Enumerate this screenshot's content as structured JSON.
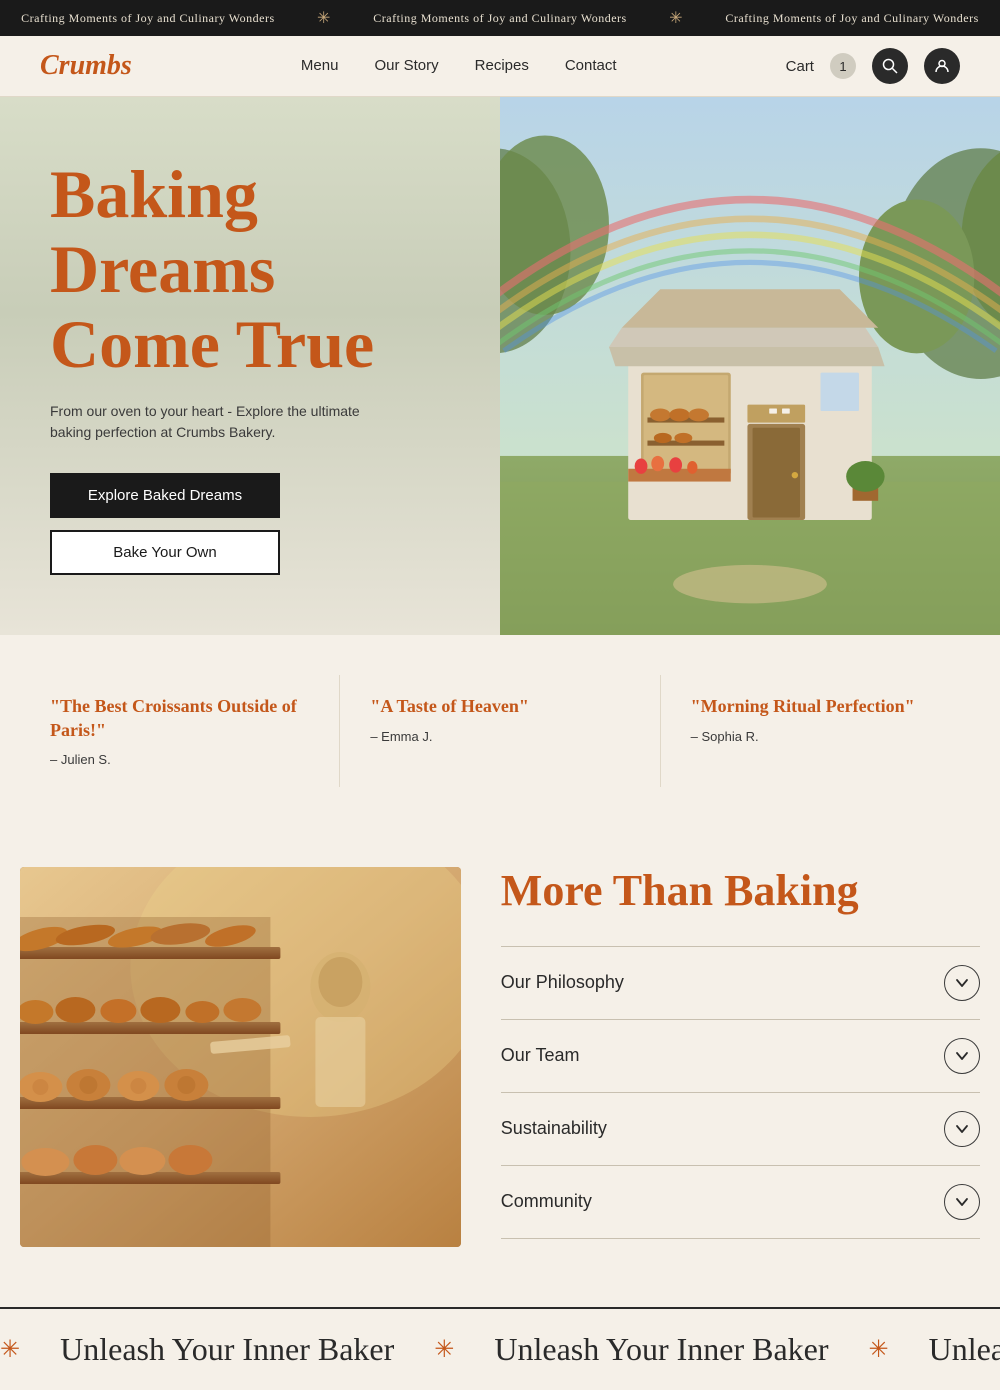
{
  "announcement": {
    "text": "Crafting Moments of Joy and Culinary Wonders",
    "separator": "✳"
  },
  "header": {
    "logo": "Crumbs",
    "nav": [
      {
        "label": "Menu",
        "href": "#"
      },
      {
        "label": "Our Story",
        "href": "#"
      },
      {
        "label": "Recipes",
        "href": "#"
      },
      {
        "label": "Contact",
        "href": "#"
      }
    ],
    "cart_label": "Cart",
    "cart_count": "1"
  },
  "hero": {
    "title_line1": "Baking",
    "title_line2": "Dreams",
    "title_line3": "Come True",
    "subtitle": "From our oven to your heart - Explore the ultimate baking perfection at Crumbs Bakery.",
    "btn_primary": "Explore Baked Dreams",
    "btn_secondary": "Bake Your Own"
  },
  "testimonials": [
    {
      "quote": "\"The Best Croissants Outside of Paris!\"",
      "author": "– Julien S."
    },
    {
      "quote": "\"A Taste of Heaven\"",
      "author": "– Emma J."
    },
    {
      "quote": "\"Morning Ritual Perfection\"",
      "author": "– Sophia R."
    }
  ],
  "more_than_baking": {
    "heading": "More Than Baking",
    "accordion": [
      {
        "label": "Our Philosophy"
      },
      {
        "label": "Our Team"
      },
      {
        "label": "Sustainability"
      },
      {
        "label": "Community"
      }
    ]
  },
  "bottom_banner": {
    "text": "Unleash Your Inner Baker",
    "separator": "✳"
  }
}
